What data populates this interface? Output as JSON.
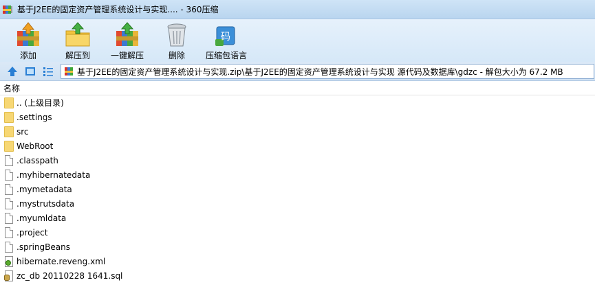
{
  "window": {
    "title": "基于J2EE的固定资产管理系统设计与实现.... - 360压缩"
  },
  "toolbar": {
    "items": [
      {
        "label": "添加",
        "icon": "add-archive-icon"
      },
      {
        "label": "解压到",
        "icon": "extract-to-icon"
      },
      {
        "label": "一键解压",
        "icon": "one-click-extract-icon"
      },
      {
        "label": "删除",
        "icon": "delete-trash-icon"
      },
      {
        "label": "压缩包语言",
        "icon": "archive-language-icon"
      }
    ]
  },
  "address": {
    "path": "基于J2EE的固定资产管理系统设计与实现.zip\\基于J2EE的固定资产管理系统设计与实现 源代码及数据库\\gdzc - 解包大小为 67.2 MB"
  },
  "list": {
    "column_name": "名称",
    "files": [
      {
        "name": ".. (上级目录)",
        "type": "folder"
      },
      {
        "name": ".settings",
        "type": "folder"
      },
      {
        "name": "src",
        "type": "folder"
      },
      {
        "name": "WebRoot",
        "type": "folder"
      },
      {
        "name": ".classpath",
        "type": "file"
      },
      {
        "name": ".myhibernatedata",
        "type": "file"
      },
      {
        "name": ".mymetadata",
        "type": "file"
      },
      {
        "name": ".mystrutsdata",
        "type": "file"
      },
      {
        "name": ".myumldata",
        "type": "file"
      },
      {
        "name": ".project",
        "type": "file"
      },
      {
        "name": ".springBeans",
        "type": "file"
      },
      {
        "name": "hibernate.reveng.xml",
        "type": "xml"
      },
      {
        "name": "zc_db 20110228 1641.sql",
        "type": "sql"
      }
    ]
  },
  "colors": {
    "toolbar_bg": "#d6e8f8",
    "folder": "#f7d774",
    "accent": "#2a7fd4"
  }
}
